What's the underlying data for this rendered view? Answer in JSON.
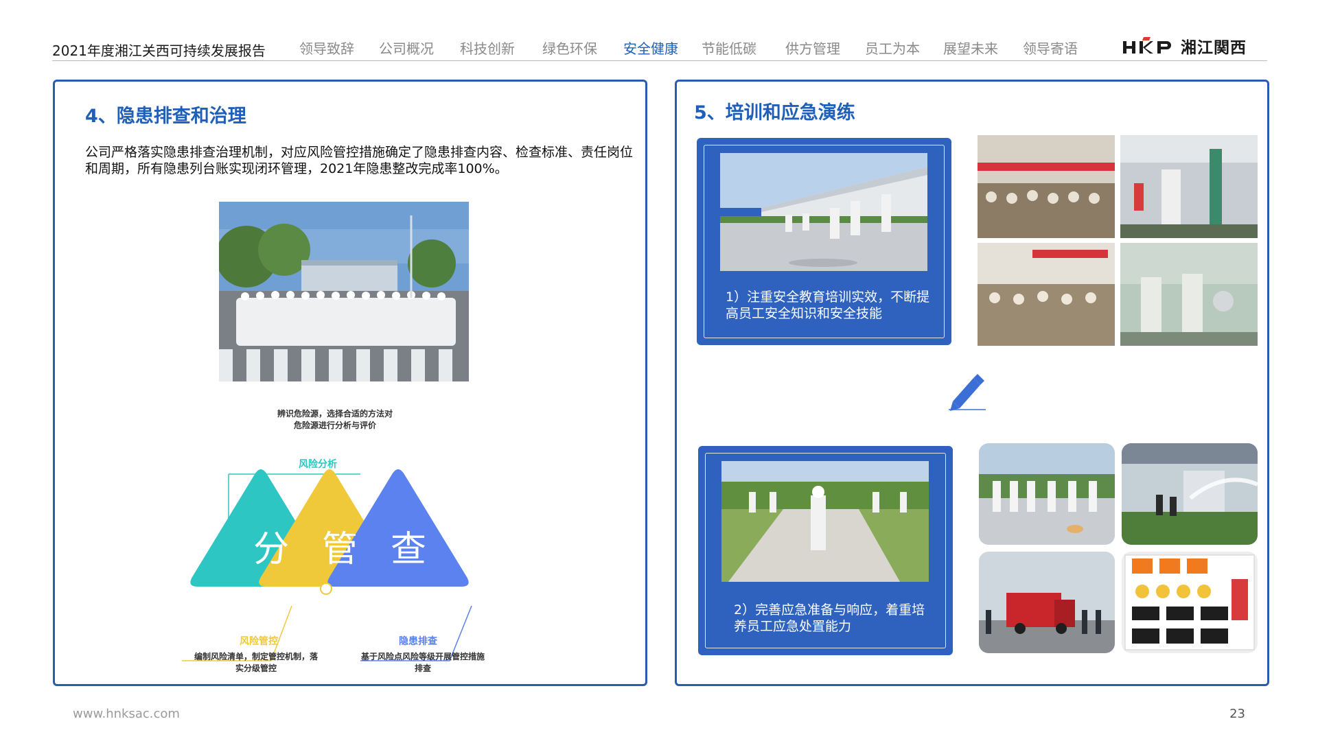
{
  "header": {
    "doc_title": "2021年度湘江关西可持续发展报告",
    "nav": [
      {
        "label": "领导致辞",
        "active": false
      },
      {
        "label": "公司概况",
        "active": false
      },
      {
        "label": "科技创新",
        "active": false
      },
      {
        "label": "绿色环保",
        "active": false
      },
      {
        "label": "安全健康",
        "active": true
      },
      {
        "label": "节能低碳",
        "active": false
      },
      {
        "label": "供方管理",
        "active": false
      },
      {
        "label": "员工为本",
        "active": false
      },
      {
        "label": "展望未来",
        "active": false
      },
      {
        "label": "领导寄语",
        "active": false
      }
    ],
    "logo_mark": "HKP",
    "logo_text": "湘江関西"
  },
  "left_panel": {
    "title": "4、隐患排查和治理",
    "intro": "公司严格落实隐患排查治理机制，对应风险管控措施确定了隐患排查内容、检查标准、责任岗位和周期，所有隐患列台账实现闭环管理，2021年隐患整改完成率100%。",
    "diagram": {
      "top_desc": "辨识危险源，选择合适的方法对危险源进行分析与评价",
      "top_label": "风险分析",
      "chars": [
        "分",
        "管",
        "查"
      ],
      "bottom_left_label": "风险管控",
      "bottom_left_desc": "编制风险清单，制定管控机制，落实分级管控",
      "bottom_right_label": "隐患排查",
      "bottom_right_desc": "基于风险点风险等级开展管控措施排查",
      "colors": {
        "teal": "#2ec6c3",
        "yellow": "#f0c93a",
        "blue": "#5b82ef"
      }
    }
  },
  "right_panel": {
    "title": "5、培训和应急演练",
    "card1_text": "1）注重安全教育培训实效，不断提高员工安全知识和安全技能",
    "card2_text": "2）完善应急准备与响应，着重培养员工应急处置能力"
  },
  "footer": {
    "url": "www.hnksac.com",
    "page": "23"
  },
  "colors": {
    "accent": "#1f5fb8",
    "card": "#2f62bf"
  }
}
